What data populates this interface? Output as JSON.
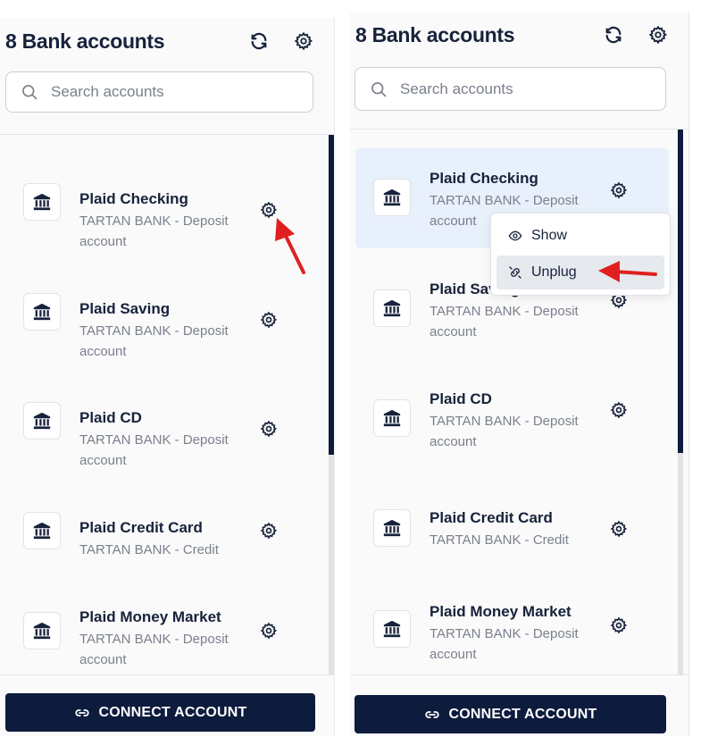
{
  "panels": [
    {
      "id": "left",
      "title": "8 Bank accounts",
      "search_placeholder": "Search accounts",
      "accounts": [
        {
          "name": "Plaid Checking",
          "subtitle": "TARTAN BANK - Deposit account"
        },
        {
          "name": "Plaid Saving",
          "subtitle": "TARTAN BANK - Deposit account"
        },
        {
          "name": "Plaid CD",
          "subtitle": "TARTAN BANK - Deposit account"
        },
        {
          "name": "Plaid Credit Card",
          "subtitle": "TARTAN BANK - Credit"
        },
        {
          "name": "Plaid Money Market",
          "subtitle": "TARTAN BANK - Deposit account"
        }
      ],
      "connect_label": "CONNECT ACCOUNT"
    },
    {
      "id": "right",
      "title": "8 Bank accounts",
      "search_placeholder": "Search accounts",
      "accounts": [
        {
          "name": "Plaid Checking",
          "subtitle": "TARTAN BANK - Deposit account",
          "selected": true
        },
        {
          "name": "Plaid Saving",
          "subtitle": "TARTAN BANK - Deposit account"
        },
        {
          "name": "Plaid CD",
          "subtitle": "TARTAN BANK - Deposit account"
        },
        {
          "name": "Plaid Credit Card",
          "subtitle": "TARTAN BANK - Credit"
        },
        {
          "name": "Plaid Money Market",
          "subtitle": "TARTAN BANK - Deposit account"
        }
      ],
      "connect_label": "CONNECT ACCOUNT",
      "context_menu": {
        "items": [
          {
            "label": "Show",
            "icon": "eye-icon"
          },
          {
            "label": "Unplug",
            "icon": "unlink-icon",
            "hovered": true
          }
        ]
      }
    }
  ],
  "colors": {
    "navy": "#0d1b3d",
    "selected_row": "#e8f0fc",
    "arrow": "#e02020"
  }
}
